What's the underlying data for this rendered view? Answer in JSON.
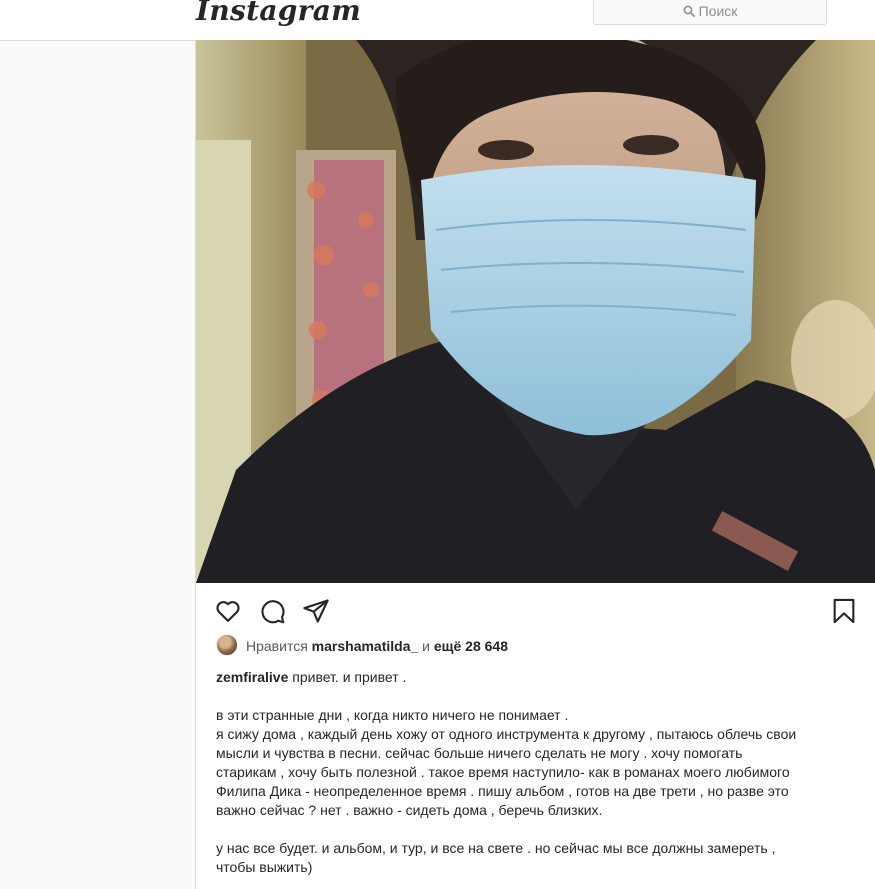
{
  "header": {
    "logo": "Instagram",
    "search_placeholder": "Поиск"
  },
  "post": {
    "likes": {
      "prefix": "Нравится",
      "user": "marshamatilda_",
      "connector": "и",
      "more": "ещё 28 648"
    },
    "caption": {
      "author": "zemfiralive",
      "first_line": "привет. и привет .",
      "lines": [
        "в эти странные дни , когда никто ничего не понимает .",
        "я сижу дома , каждый день хожу от одного инструмента к другому , пытаюсь облечь свои",
        "мысли и чувства в песни. сейчас больше ничего сделать не могу . хочу помогать",
        "старикам , хочу быть полезной . такое время наступило- как в романах моего любимого",
        "Филипа Дика - неопределенное время . пишу альбом , готов на две трети , но разве это",
        "важно сейчас ? нет . важно - сидеть дома , беречь близких."
      ],
      "closing_lines": [
        "у нас все будет. и альбом, и тур, и все на свете . но сейчас мы все должны замереть ,",
        "чтобы выжить)"
      ]
    },
    "icons": {
      "like": "heart-icon",
      "comment": "comment-icon",
      "share": "paper-plane-icon",
      "save": "bookmark-icon"
    }
  },
  "colors": {
    "border": "#dbdbdb",
    "text": "#262626",
    "muted": "#8e8e8e",
    "mask": "#a9cfe3"
  }
}
